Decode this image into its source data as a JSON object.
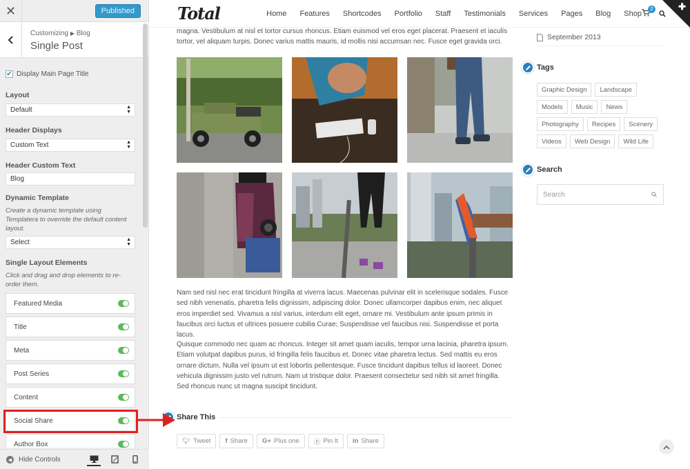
{
  "customizer": {
    "publish_label": "Published",
    "breadcrumb_root": "Customizing",
    "breadcrumb_section": "Blog",
    "section_title": "Single Post",
    "display_title_label": "Display Main Page Title",
    "layout_label": "Layout",
    "layout_value": "Default",
    "header_displays_label": "Header Displays",
    "header_displays_value": "Custom Text",
    "header_custom_text_label": "Header Custom Text",
    "header_custom_text_value": "Blog",
    "dynamic_template_label": "Dynamic Template",
    "dynamic_template_desc": "Create a dynamic template using Templatera to override the default content layout.",
    "dynamic_template_value": "Select",
    "single_layout_label": "Single Layout Elements",
    "single_layout_desc": "Click and drag and drop elements to re-order them.",
    "elements": [
      "Featured Media",
      "Title",
      "Meta",
      "Post Series",
      "Content",
      "Social Share",
      "Author Box"
    ],
    "hide_controls": "Hide Controls"
  },
  "site": {
    "logo": "Total",
    "menu": [
      "Home",
      "Features",
      "Shortcodes",
      "Portfolio",
      "Staff",
      "Testimonials",
      "Services",
      "Pages",
      "Blog",
      "Shop"
    ],
    "cart_count": "2",
    "intro_text": "magna. Vestibulum at nisl et tortor cursus rhoncus. Etiam euismod vel eros eget placerat. Praesent et iaculis tortor, vel aliquam turpis. Donec varius mattis mauris, id mollis nisi accumsan nec. Fusce eget gravida orci.",
    "para1": "Nam sed nisl nec erat tincidunt fringilla at viverra lacus. Maecenas pulvinar elit in scelerisque sodales. Fusce sed nibh venenatis, pharetra felis dignissim, adipiscing dolor. Donec ullamcorper dapibus enim, nec aliquet eros imperdiet sed. Vivamus a nisl varius, interdum elit eget, ornare mi. Vestibulum ante ipsum primis in faucibus orci luctus et ultrices posuere cubilia Curae; Suspendisse vel faucibus nisi. Suspendisse et porta lacus.",
    "para2": "Quisque commodo nec quam ac rhoncus. Integer sit amet quam iaculis, tempor urna lacinia, pharetra ipsum. Etiam volutpat dapibus purus, id fringilla felis faucibus et. Donec vitae pharetra lectus. Sed mattis eu eros ornare dictum. Nulla vel ipsum ut est lobortis pellentesque. Fusce tincidunt dapibus tellus id laoreet. Donec vehicula dignissim justo vel rutrum. Nam ut tristique dolor. Praesent consectetur sed nibh sit amet fringilla. Sed rhoncus nunc ut magna suscipit tincidunt.",
    "share_title": "Share This",
    "share_buttons": [
      "Tweet",
      "Share",
      "Plus one",
      "Pin It",
      "Share"
    ],
    "archive_month": "September 2013",
    "tags_title": "Tags",
    "tags": [
      "Graphic Design",
      "Landscape",
      "Models",
      "Music",
      "News",
      "Photography",
      "Recipes",
      "Scenery",
      "Videos",
      "Web Design",
      "Wild Life"
    ],
    "search_title": "Search",
    "search_placeholder": "Search"
  },
  "colors": {
    "accent": "#3399cc",
    "toggle_on": "#5cb85c",
    "highlight": "#e02020"
  }
}
